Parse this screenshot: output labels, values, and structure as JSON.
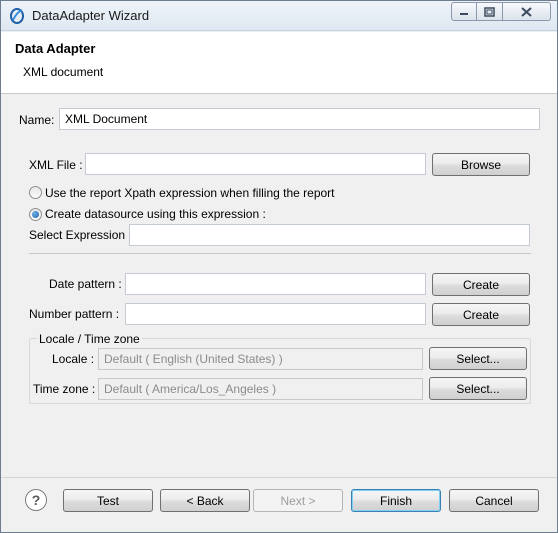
{
  "window": {
    "title": "DataAdapter Wizard"
  },
  "header": {
    "title": "Data Adapter",
    "subtitle": "XML document"
  },
  "name": {
    "label": "Name:",
    "value": "XML Document"
  },
  "xml_file": {
    "label": "XML File :",
    "value": "",
    "browse": "Browse"
  },
  "mode": {
    "option_report": "Use the report Xpath expression when filling the report",
    "option_datasource": "Create datasource using this expression :",
    "selected": "datasource"
  },
  "select_expression": {
    "label": "Select Expression :",
    "value": ""
  },
  "date_pattern": {
    "label": "Date pattern :",
    "value": "",
    "button": "Create"
  },
  "number_pattern": {
    "label": "Number pattern :",
    "value": "",
    "button": "Create"
  },
  "locale_group": {
    "title": "Locale / Time zone",
    "locale_label": "Locale :",
    "locale_value": "Default ( English (United States) )",
    "locale_button": "Select...",
    "timezone_label": "Time zone :",
    "timezone_value": "Default ( America/Los_Angeles )",
    "timezone_button": "Select..."
  },
  "footer": {
    "help": "?",
    "test": "Test",
    "back": "< Back",
    "next": "Next >",
    "finish": "Finish",
    "cancel": "Cancel"
  }
}
